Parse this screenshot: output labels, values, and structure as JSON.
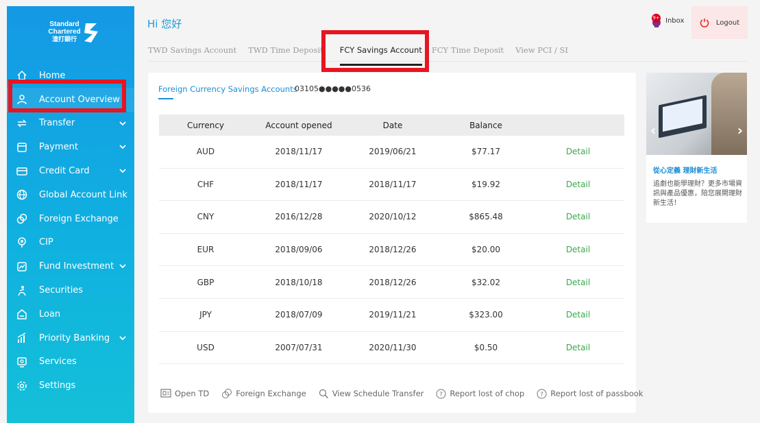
{
  "brand": {
    "logo_lines": [
      "Standard",
      "Chartered",
      "渣打銀行"
    ]
  },
  "sidebar": {
    "items": [
      {
        "label": "Home",
        "icon": "home-icon",
        "has_chevron": false
      },
      {
        "label": "Account Overview",
        "icon": "user-icon",
        "has_chevron": false
      },
      {
        "label": "Transfer",
        "icon": "transfer-icon",
        "has_chevron": true
      },
      {
        "label": "Payment",
        "icon": "payment-icon",
        "has_chevron": true
      },
      {
        "label": "Credit Card",
        "icon": "credit-card-icon",
        "has_chevron": true
      },
      {
        "label": "Global Account Link",
        "icon": "globe-icon",
        "has_chevron": false
      },
      {
        "label": "Foreign Exchange",
        "icon": "exchange-icon",
        "has_chevron": false
      },
      {
        "label": "CIP",
        "icon": "cip-icon",
        "has_chevron": false
      },
      {
        "label": "Fund Investment",
        "icon": "fund-icon",
        "has_chevron": true
      },
      {
        "label": "Securities",
        "icon": "securities-icon",
        "has_chevron": false
      },
      {
        "label": "Loan",
        "icon": "loan-icon",
        "has_chevron": false
      },
      {
        "label": "Priority Banking",
        "icon": "priority-banking-icon",
        "has_chevron": true
      },
      {
        "label": "Services",
        "icon": "services-icon",
        "has_chevron": false
      },
      {
        "label": "Settings",
        "icon": "settings-icon",
        "has_chevron": false
      }
    ]
  },
  "header": {
    "greeting": "Hi 您好",
    "inbox_label": "Inbox",
    "inbox_badge": "9+",
    "logout_label": "Logout"
  },
  "tabs": [
    {
      "label": "TWD Savings Account",
      "active": false
    },
    {
      "label": "TWD Time Deposit",
      "active": false
    },
    {
      "label": "FCY Savings Account",
      "active": true
    },
    {
      "label": "FCY Time Deposit",
      "active": false
    },
    {
      "label": "View PCI / SI",
      "active": false
    }
  ],
  "account": {
    "link_label": "Foreign Currency Savings Accounts",
    "number": "03105●●●●●0536"
  },
  "table": {
    "headers": [
      "Currency",
      "Account opened",
      "Date",
      "Balance",
      ""
    ],
    "rows": [
      {
        "currency": "AUD",
        "opened": "2018/11/17",
        "date": "2019/06/21",
        "balance": "$77.17",
        "action": "Detail"
      },
      {
        "currency": "CHF",
        "opened": "2018/11/17",
        "date": "2018/11/17",
        "balance": "$19.92",
        "action": "Detail"
      },
      {
        "currency": "CNY",
        "opened": "2016/12/28",
        "date": "2020/10/12",
        "balance": "$865.48",
        "action": "Detail"
      },
      {
        "currency": "EUR",
        "opened": "2018/09/06",
        "date": "2018/12/26",
        "balance": "$20.00",
        "action": "Detail"
      },
      {
        "currency": "GBP",
        "opened": "2018/10/18",
        "date": "2018/12/26",
        "balance": "$32.02",
        "action": "Detail"
      },
      {
        "currency": "JPY",
        "opened": "2018/07/09",
        "date": "2019/11/21",
        "balance": "$323.00",
        "action": "Detail"
      },
      {
        "currency": "USD",
        "opened": "2007/07/31",
        "date": "2020/11/30",
        "balance": "$0.50",
        "action": "Detail"
      }
    ]
  },
  "actions": [
    {
      "label": "Open TD",
      "icon": "open-td-icon"
    },
    {
      "label": "Foreign Exchange",
      "icon": "exchange-icon"
    },
    {
      "label": "View Schedule Transfer",
      "icon": "search-icon"
    },
    {
      "label": "Report lost of chop",
      "icon": "question-icon"
    },
    {
      "label": "Report lost of passbook",
      "icon": "question-icon"
    }
  ],
  "promo": {
    "title": "從心定義 理財新生活",
    "body": "追劇也能學理財？更多市場資訊與產品優惠，陪您展開理財新生活！"
  },
  "colors": {
    "sidebar_top": "#1499e5",
    "sidebar_bottom": "#14c0d8",
    "accent_blue": "#1a8ed6",
    "detail_green": "#3aa84c",
    "highlight_red": "#e8141f",
    "logout_bg": "#fbe7e7"
  }
}
